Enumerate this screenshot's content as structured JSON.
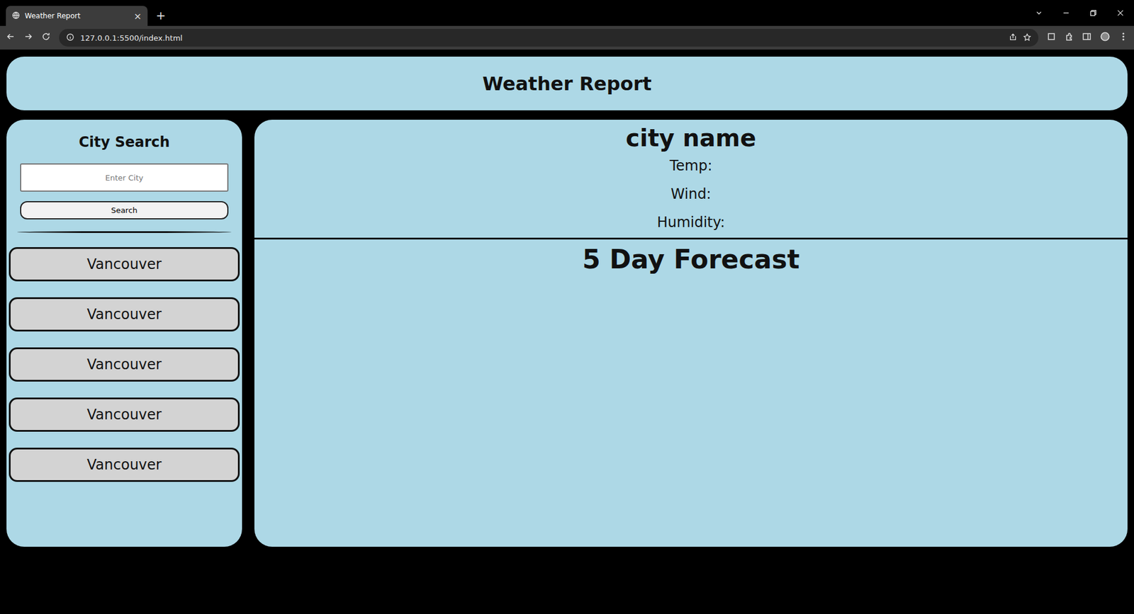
{
  "window": {
    "title": "Weather Report",
    "tab_close": "×",
    "new_tab": "+"
  },
  "browser": {
    "url": "127.0.0.1:5500/index.html"
  },
  "header": {
    "title": "Weather Report"
  },
  "sidebar": {
    "title": "City Search",
    "search": {
      "placeholder": "Enter City",
      "button": "Search"
    },
    "history": [
      "Vancouver",
      "Vancouver",
      "Vancouver",
      "Vancouver",
      "Vancouver"
    ]
  },
  "current": {
    "city": "city name",
    "stats": [
      "Temp:",
      "Wind:",
      "Humidity:"
    ]
  },
  "forecast": {
    "title": "5 Day Forecast"
  }
}
